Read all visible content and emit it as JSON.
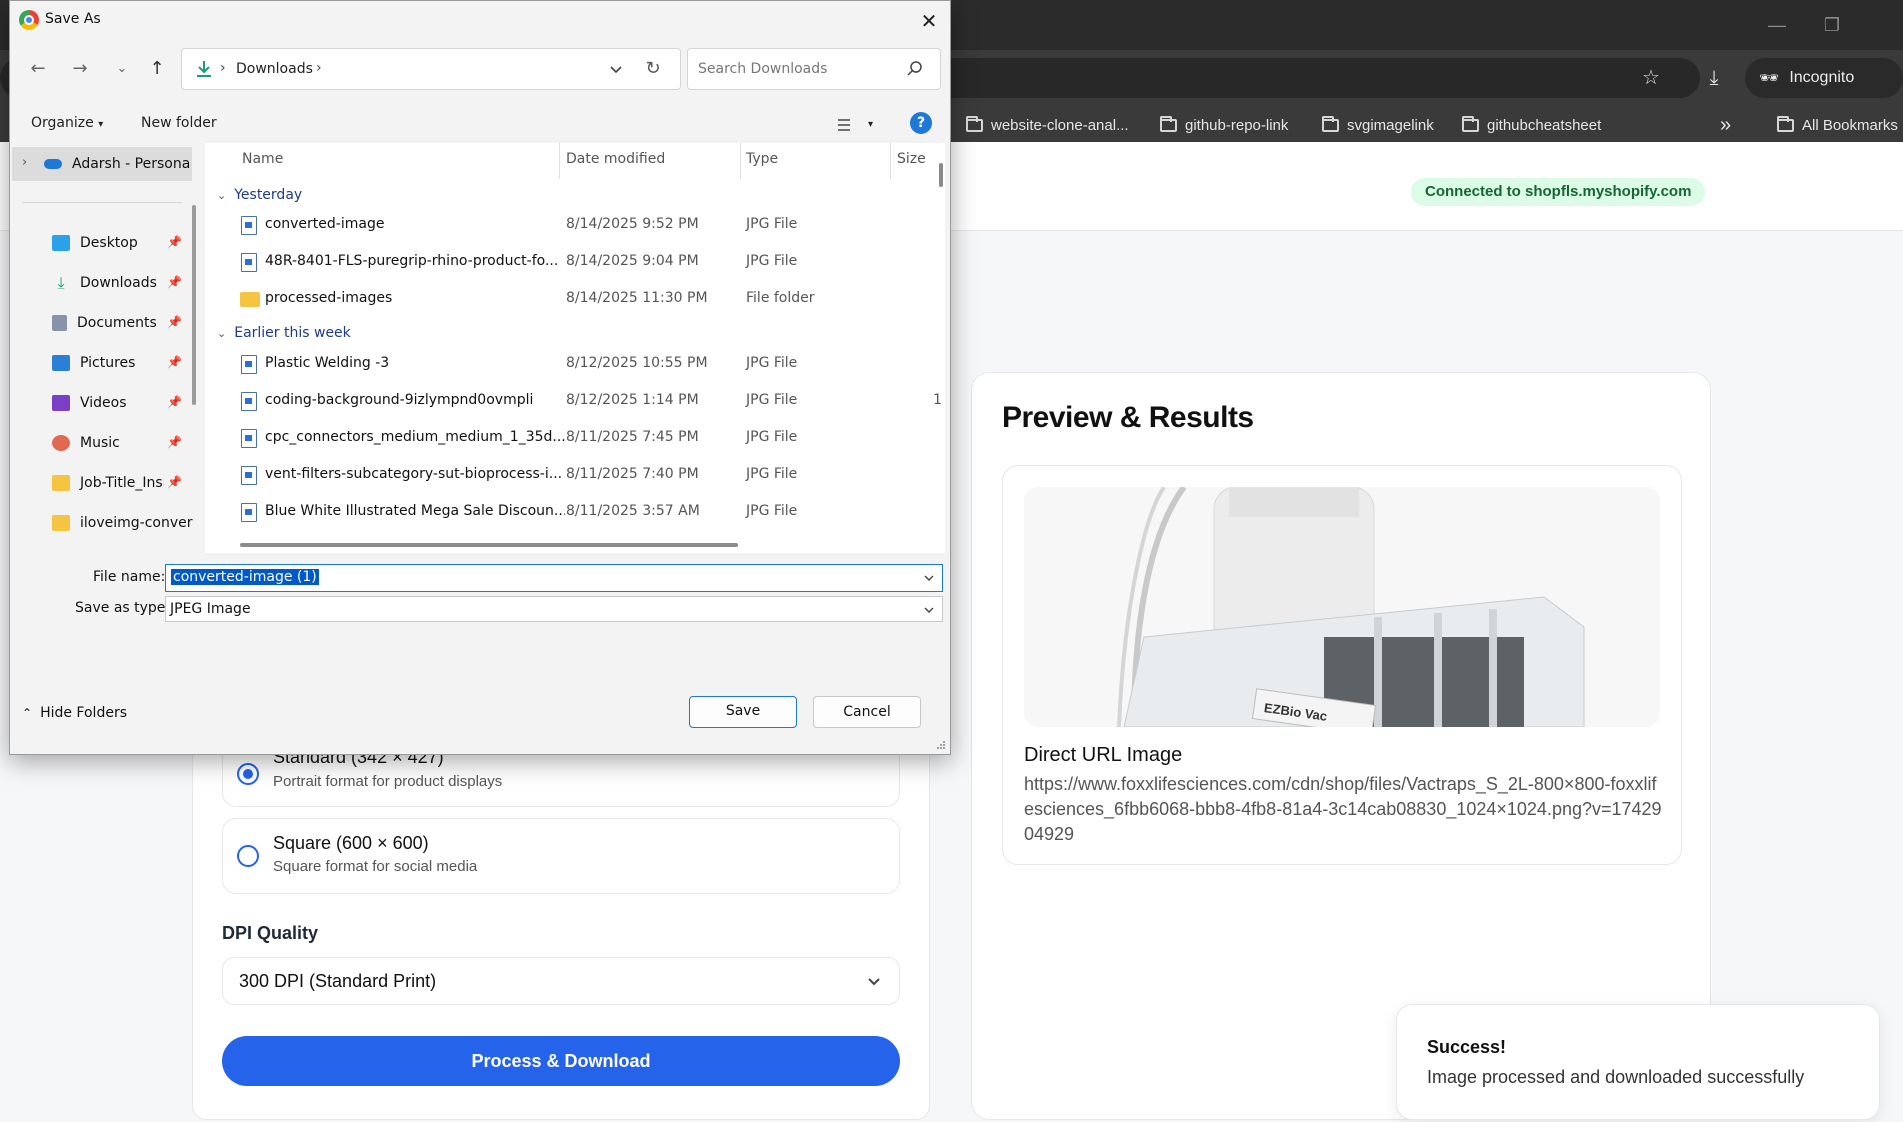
{
  "browser": {
    "incognito_label": "Incognito",
    "bookmarks": [
      {
        "label": "website-clone-anal..."
      },
      {
        "label": "github-repo-link"
      },
      {
        "label": "svgimagelink"
      },
      {
        "label": "githubcheatsheet"
      }
    ],
    "more_label": "»",
    "all_bookmarks_label": "All Bookmarks"
  },
  "page": {
    "connected_badge": "Connected to shopfls.myshopify.com",
    "size_options": [
      {
        "title": "Standard (342 × 427)",
        "desc": "Portrait format for product displays",
        "selected": true
      },
      {
        "title": "Square (600 × 600)",
        "desc": "Square format for social media",
        "selected": false
      }
    ],
    "dpi_label": "DPI Quality",
    "dpi_value": "300 DPI (Standard Print)",
    "process_button": "Process & Download",
    "preview_title": "Preview & Results",
    "direct_url_title": "Direct URL Image",
    "direct_url": "https://www.foxxlifesciences.com/cdn/shop/files/Vactraps_S_2L-800×800-foxxlifesciences_6fbb6068-bbb8-4fb8-81a4-3c14cab08830_1024×1024.png?v=1742904929",
    "product_label": "EZBio Vac",
    "toast_title": "Success!",
    "toast_message": "Image processed and downloaded successfully"
  },
  "dialog": {
    "title": "Save As",
    "address_path": "Downloads",
    "search_placeholder": "Search Downloads",
    "organize_label": "Organize",
    "new_folder_label": "New folder",
    "help_glyph": "?",
    "nav_items": [
      {
        "label": "Adarsh - Persona",
        "icon": "onedrive-icon",
        "color": "#1e78d7"
      },
      {
        "label": "Desktop",
        "icon": "desktop-icon",
        "color": "#2aa1e8"
      },
      {
        "label": "Downloads",
        "icon": "downloads-icon",
        "color": "#1a9a7a"
      },
      {
        "label": "Documents",
        "icon": "documents-icon",
        "color": "#8793a8"
      },
      {
        "label": "Pictures",
        "icon": "pictures-icon",
        "color": "#2b7fd6"
      },
      {
        "label": "Videos",
        "icon": "videos-icon",
        "color": "#7b3fc7"
      },
      {
        "label": "Music",
        "icon": "music-icon",
        "color": "#e0694f"
      },
      {
        "label": "Job-Title_Insi",
        "icon": "folder-icon",
        "color": "#f5c542"
      },
      {
        "label": "iloveimg-conver",
        "icon": "folder-icon",
        "color": "#f5c542"
      }
    ],
    "columns": {
      "name": "Name",
      "date": "Date modified",
      "type": "Type",
      "size": "Size"
    },
    "groups": [
      {
        "label": "Yesterday",
        "files": [
          {
            "name": "converted-image",
            "date": "8/14/2025 9:52 PM",
            "type": "JPG File",
            "size": "",
            "kind": "file"
          },
          {
            "name": "48R-8401-FLS-puregrip-rhino-product-fo...",
            "date": "8/14/2025 9:04 PM",
            "type": "JPG File",
            "size": "",
            "kind": "file"
          },
          {
            "name": "processed-images",
            "date": "8/14/2025 11:30 PM",
            "type": "File folder",
            "size": "",
            "kind": "folder"
          }
        ]
      },
      {
        "label": "Earlier this week",
        "files": [
          {
            "name": "Plastic Welding -3",
            "date": "8/12/2025 10:55 PM",
            "type": "JPG File",
            "size": "",
            "kind": "file"
          },
          {
            "name": "coding-background-9izlympnd0ovmpli",
            "date": "8/12/2025 1:14 PM",
            "type": "JPG File",
            "size": "1",
            "kind": "file"
          },
          {
            "name": "cpc_connectors_medium_medium_1_35d...",
            "date": "8/11/2025 7:45 PM",
            "type": "JPG File",
            "size": "",
            "kind": "file"
          },
          {
            "name": "vent-filters-subcategory-sut-bioprocess-i...",
            "date": "8/11/2025 7:40 PM",
            "type": "JPG File",
            "size": "",
            "kind": "file"
          },
          {
            "name": "Blue White Illustrated Mega Sale Discoun...",
            "date": "8/11/2025 3:57 AM",
            "type": "JPG File",
            "size": "",
            "kind": "file"
          }
        ]
      }
    ],
    "file_name_label": "File name:",
    "file_name_value": "converted-image (1)",
    "save_as_type_label": "Save as type:",
    "save_as_type_value": "JPEG Image",
    "hide_folders_label": "Hide Folders",
    "save_button": "Save",
    "cancel_button": "Cancel"
  }
}
